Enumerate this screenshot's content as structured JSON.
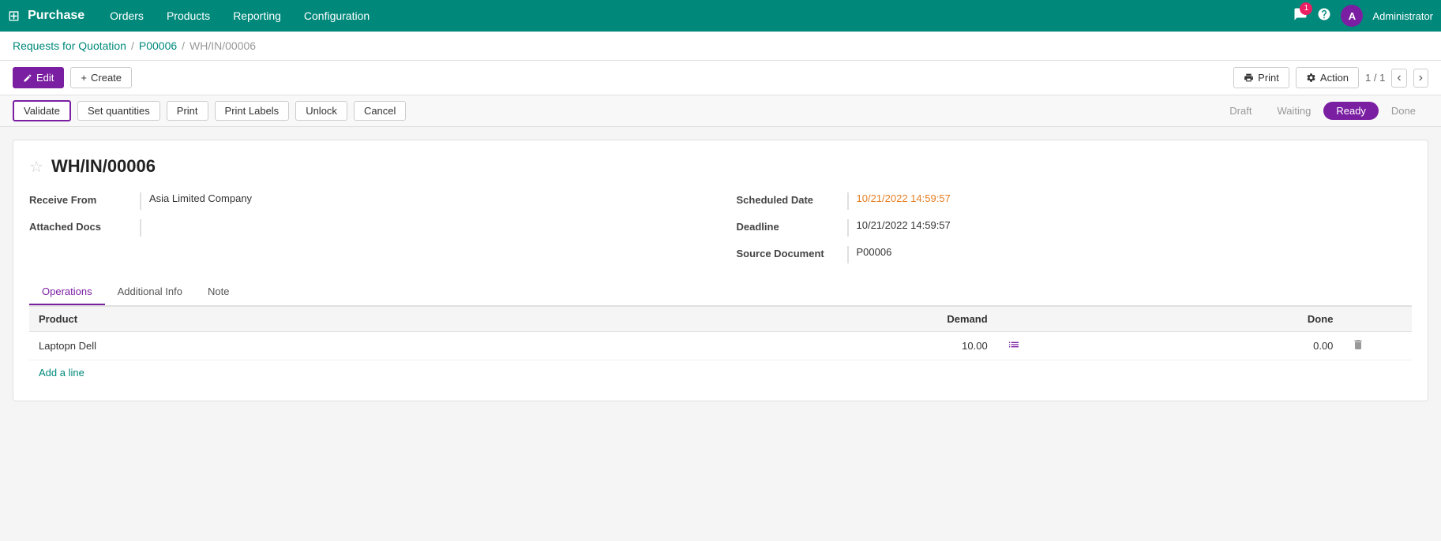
{
  "app": {
    "name": "Purchase",
    "grid_icon": "⊞"
  },
  "nav": {
    "items": [
      {
        "label": "Orders"
      },
      {
        "label": "Products"
      },
      {
        "label": "Reporting"
      },
      {
        "label": "Configuration"
      }
    ]
  },
  "topright": {
    "badge_count": "1",
    "avatar_letter": "A",
    "admin_label": "Administrator"
  },
  "breadcrumb": {
    "part1": "Requests for Quotation",
    "sep1": "/",
    "part2": "P00006",
    "sep2": "/",
    "current": "WH/IN/00006"
  },
  "toolbar": {
    "edit_label": "Edit",
    "create_label": "Create",
    "print_label": "Print",
    "action_label": "Action",
    "pagination": "1 / 1"
  },
  "actions": {
    "validate_label": "Validate",
    "set_quantities_label": "Set quantities",
    "print_label": "Print",
    "print_labels_label": "Print Labels",
    "unlock_label": "Unlock",
    "cancel_label": "Cancel"
  },
  "status_steps": [
    {
      "label": "Draft",
      "active": false
    },
    {
      "label": "Waiting",
      "active": false
    },
    {
      "label": "Ready",
      "active": true
    },
    {
      "label": "Done",
      "active": false
    }
  ],
  "record": {
    "title": "WH/IN/00006",
    "receive_from_label": "Receive From",
    "receive_from_value": "Asia Limited Company",
    "attached_docs_label": "Attached Docs",
    "attached_docs_value": "",
    "scheduled_date_label": "Scheduled Date",
    "scheduled_date_value": "10/21/2022 14:59:57",
    "deadline_label": "Deadline",
    "deadline_value": "10/21/2022 14:59:57",
    "source_doc_label": "Source Document",
    "source_doc_value": "P00006"
  },
  "tabs": [
    {
      "label": "Operations",
      "active": true
    },
    {
      "label": "Additional Info",
      "active": false
    },
    {
      "label": "Note",
      "active": false
    }
  ],
  "table": {
    "headers": [
      {
        "label": "Product",
        "align": "left"
      },
      {
        "label": "Demand",
        "align": "right"
      },
      {
        "label": "",
        "align": "left"
      },
      {
        "label": "Done",
        "align": "right"
      },
      {
        "label": "",
        "align": "left"
      }
    ],
    "rows": [
      {
        "product": "Laptopn Dell",
        "demand": "10.00",
        "done": "0.00"
      }
    ],
    "add_line_label": "Add a line"
  }
}
